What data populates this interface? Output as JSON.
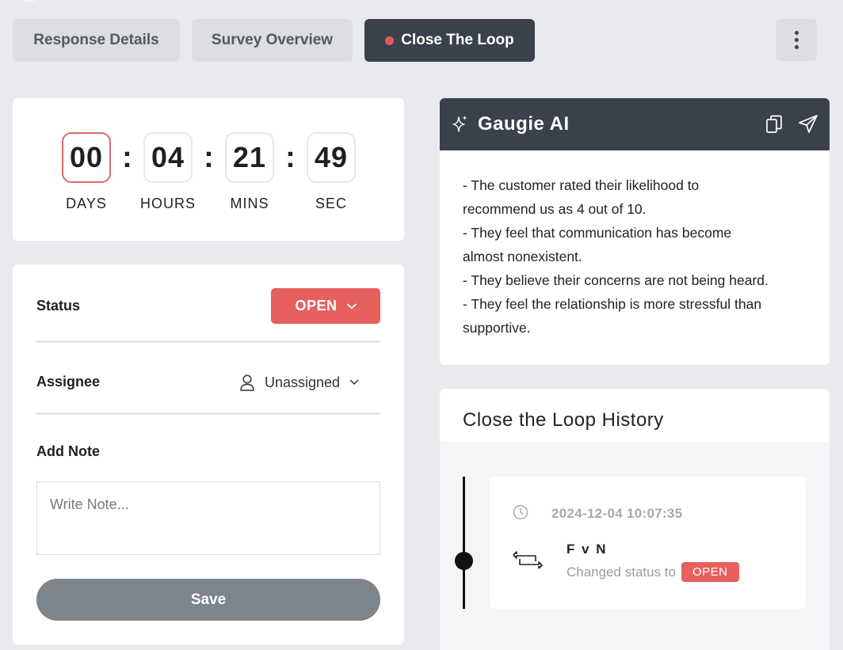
{
  "tabs": [
    {
      "label": "Response Details",
      "active": false
    },
    {
      "label": "Survey Overview",
      "active": false
    },
    {
      "label": "Close The Loop",
      "active": true
    }
  ],
  "countdown": {
    "days": {
      "value": "00",
      "label": "DAYS"
    },
    "hours": {
      "value": "04",
      "label": "HOURS"
    },
    "mins": {
      "value": "21",
      "label": "MINS"
    },
    "sec": {
      "value": "49",
      "label": "SEC"
    },
    "separator": ":"
  },
  "panel": {
    "status_label": "Status",
    "status_value": "OPEN",
    "assignee_label": "Assignee",
    "assignee_value": "Unassigned",
    "note_label": "Add Note",
    "note_placeholder": "Write Note...",
    "save_label": "Save"
  },
  "ai": {
    "title": "Gaugie AI",
    "lines": [
      "- The customer rated their likelihood to",
      "recommend us as 4 out of 10.",
      "- They feel that communication has become",
      "almost nonexistent.",
      "- They believe their concerns are not being heard.",
      "- They feel the relationship is more stressful than",
      "supportive."
    ]
  },
  "history": {
    "title": "Close the Loop History",
    "entries": [
      {
        "timestamp": "2024-12-04 10:07:35",
        "user": "F v N",
        "change_text": "Changed status to",
        "status": "OPEN"
      }
    ]
  },
  "colors": {
    "accent_red": "#e6605e",
    "dark": "#3a414b",
    "save_gray": "#7c848c"
  }
}
